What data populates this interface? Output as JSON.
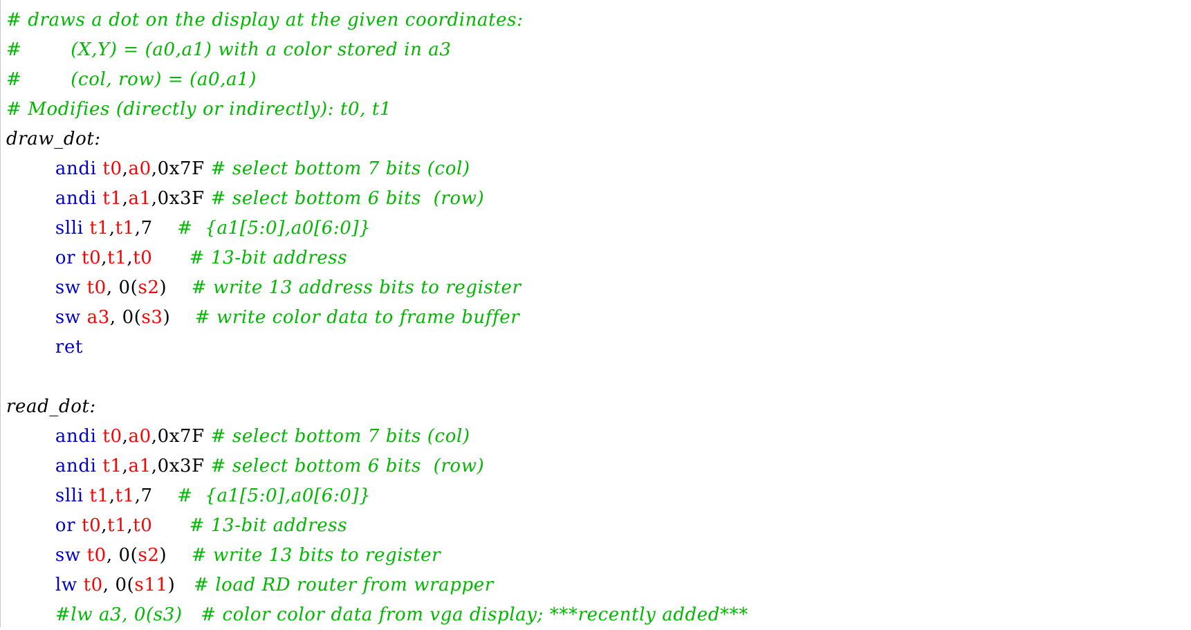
{
  "editor": {
    "lines": [
      [
        {
          "t": "# draws a dot on the display at the given coordinates:",
          "c": "comment"
        }
      ],
      [
        {
          "t": "#\t(X,Y) = (a0,a1) with a color stored in a3",
          "c": "comment"
        }
      ],
      [
        {
          "t": "#\t(col, row) = (a0,a1)",
          "c": "comment"
        }
      ],
      [
        {
          "t": "# Modifies (directly or indirectly): t0, t1",
          "c": "comment"
        }
      ],
      [
        {
          "t": "draw_dot:",
          "c": "label"
        }
      ],
      [
        {
          "t": "\t",
          "c": "punct"
        },
        {
          "t": "andi",
          "c": "instr"
        },
        {
          "t": " ",
          "c": "punct"
        },
        {
          "t": "t0",
          "c": "reg"
        },
        {
          "t": ",",
          "c": "punct"
        },
        {
          "t": "a0",
          "c": "reg"
        },
        {
          "t": ",0x7F ",
          "c": "imm"
        },
        {
          "t": "# select bottom 7 bits (col)",
          "c": "comment"
        }
      ],
      [
        {
          "t": "\t",
          "c": "punct"
        },
        {
          "t": "andi",
          "c": "instr"
        },
        {
          "t": " ",
          "c": "punct"
        },
        {
          "t": "t1",
          "c": "reg"
        },
        {
          "t": ",",
          "c": "punct"
        },
        {
          "t": "a1",
          "c": "reg"
        },
        {
          "t": ",0x3F ",
          "c": "imm"
        },
        {
          "t": "# select bottom 6 bits  (row)",
          "c": "comment"
        }
      ],
      [
        {
          "t": "\t",
          "c": "punct"
        },
        {
          "t": "slli",
          "c": "instr"
        },
        {
          "t": " ",
          "c": "punct"
        },
        {
          "t": "t1",
          "c": "reg"
        },
        {
          "t": ",",
          "c": "punct"
        },
        {
          "t": "t1",
          "c": "reg"
        },
        {
          "t": ",7    ",
          "c": "imm"
        },
        {
          "t": "#  {a1[5:0],a0[6:0]}",
          "c": "comment"
        }
      ],
      [
        {
          "t": "\t",
          "c": "punct"
        },
        {
          "t": "or",
          "c": "instr"
        },
        {
          "t": " ",
          "c": "punct"
        },
        {
          "t": "t0",
          "c": "reg"
        },
        {
          "t": ",",
          "c": "punct"
        },
        {
          "t": "t1",
          "c": "reg"
        },
        {
          "t": ",",
          "c": "punct"
        },
        {
          "t": "t0",
          "c": "reg"
        },
        {
          "t": "      ",
          "c": "punct"
        },
        {
          "t": "# 13-bit address",
          "c": "comment"
        }
      ],
      [
        {
          "t": "\t",
          "c": "punct"
        },
        {
          "t": "sw",
          "c": "instr"
        },
        {
          "t": " ",
          "c": "punct"
        },
        {
          "t": "t0",
          "c": "reg"
        },
        {
          "t": ", 0(",
          "c": "imm"
        },
        {
          "t": "s2",
          "c": "reg"
        },
        {
          "t": ")    ",
          "c": "punct"
        },
        {
          "t": "# write 13 address bits to register",
          "c": "comment"
        }
      ],
      [
        {
          "t": "\t",
          "c": "punct"
        },
        {
          "t": "sw",
          "c": "instr"
        },
        {
          "t": " ",
          "c": "punct"
        },
        {
          "t": "a3",
          "c": "reg"
        },
        {
          "t": ", 0(",
          "c": "imm"
        },
        {
          "t": "s3",
          "c": "reg"
        },
        {
          "t": ")    ",
          "c": "punct"
        },
        {
          "t": "# write color data to frame buffer",
          "c": "comment"
        }
      ],
      [
        {
          "t": "\t",
          "c": "punct"
        },
        {
          "t": "ret",
          "c": "instr"
        }
      ],
      [
        {
          "t": "",
          "c": "punct"
        }
      ],
      [
        {
          "t": "read_dot:",
          "c": "label"
        }
      ],
      [
        {
          "t": "\t",
          "c": "punct"
        },
        {
          "t": "andi",
          "c": "instr"
        },
        {
          "t": " ",
          "c": "punct"
        },
        {
          "t": "t0",
          "c": "reg"
        },
        {
          "t": ",",
          "c": "punct"
        },
        {
          "t": "a0",
          "c": "reg"
        },
        {
          "t": ",0x7F ",
          "c": "imm"
        },
        {
          "t": "# select bottom 7 bits (col)",
          "c": "comment"
        }
      ],
      [
        {
          "t": "\t",
          "c": "punct"
        },
        {
          "t": "andi",
          "c": "instr"
        },
        {
          "t": " ",
          "c": "punct"
        },
        {
          "t": "t1",
          "c": "reg"
        },
        {
          "t": ",",
          "c": "punct"
        },
        {
          "t": "a1",
          "c": "reg"
        },
        {
          "t": ",0x3F ",
          "c": "imm"
        },
        {
          "t": "# select bottom 6 bits  (row)",
          "c": "comment"
        }
      ],
      [
        {
          "t": "\t",
          "c": "punct"
        },
        {
          "t": "slli",
          "c": "instr"
        },
        {
          "t": " ",
          "c": "punct"
        },
        {
          "t": "t1",
          "c": "reg"
        },
        {
          "t": ",",
          "c": "punct"
        },
        {
          "t": "t1",
          "c": "reg"
        },
        {
          "t": ",7    ",
          "c": "imm"
        },
        {
          "t": "#  {a1[5:0],a0[6:0]}",
          "c": "comment"
        }
      ],
      [
        {
          "t": "\t",
          "c": "punct"
        },
        {
          "t": "or",
          "c": "instr"
        },
        {
          "t": " ",
          "c": "punct"
        },
        {
          "t": "t0",
          "c": "reg"
        },
        {
          "t": ",",
          "c": "punct"
        },
        {
          "t": "t1",
          "c": "reg"
        },
        {
          "t": ",",
          "c": "punct"
        },
        {
          "t": "t0",
          "c": "reg"
        },
        {
          "t": "      ",
          "c": "punct"
        },
        {
          "t": "# 13-bit address",
          "c": "comment"
        }
      ],
      [
        {
          "t": "\t",
          "c": "punct"
        },
        {
          "t": "sw",
          "c": "instr"
        },
        {
          "t": " ",
          "c": "punct"
        },
        {
          "t": "t0",
          "c": "reg"
        },
        {
          "t": ", 0(",
          "c": "imm"
        },
        {
          "t": "s2",
          "c": "reg"
        },
        {
          "t": ")    ",
          "c": "punct"
        },
        {
          "t": "# write 13 bits to register",
          "c": "comment"
        }
      ],
      [
        {
          "t": "\t",
          "c": "punct"
        },
        {
          "t": "lw",
          "c": "instr"
        },
        {
          "t": " ",
          "c": "punct"
        },
        {
          "t": "t0",
          "c": "reg"
        },
        {
          "t": ", 0(",
          "c": "imm"
        },
        {
          "t": "s11",
          "c": "reg"
        },
        {
          "t": ")   ",
          "c": "punct"
        },
        {
          "t": "# load RD router from wrapper",
          "c": "comment"
        }
      ],
      [
        {
          "t": "\t",
          "c": "punct"
        },
        {
          "t": "#lw a3, 0(s3)   ",
          "c": "comment"
        },
        {
          "t": "# color color data from vga display; ***recently added***",
          "c": "comment"
        }
      ]
    ]
  }
}
